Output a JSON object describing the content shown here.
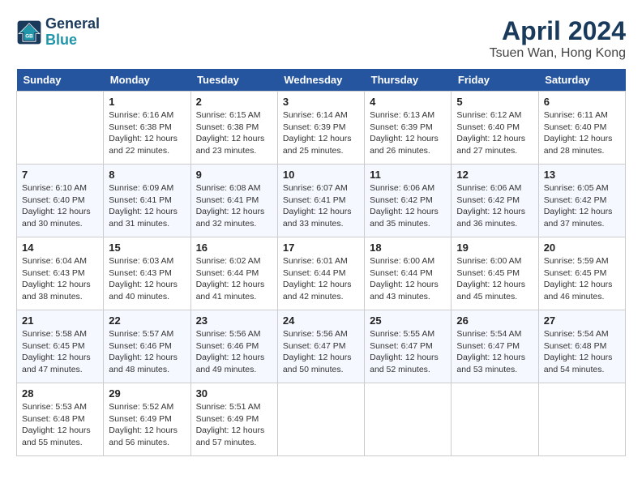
{
  "header": {
    "logo_line1": "General",
    "logo_line2": "Blue",
    "month": "April 2024",
    "location": "Tsuen Wan, Hong Kong"
  },
  "days_of_week": [
    "Sunday",
    "Monday",
    "Tuesday",
    "Wednesday",
    "Thursday",
    "Friday",
    "Saturday"
  ],
  "weeks": [
    [
      {
        "day": "",
        "info": ""
      },
      {
        "day": "1",
        "info": "Sunrise: 6:16 AM\nSunset: 6:38 PM\nDaylight: 12 hours\nand 22 minutes."
      },
      {
        "day": "2",
        "info": "Sunrise: 6:15 AM\nSunset: 6:38 PM\nDaylight: 12 hours\nand 23 minutes."
      },
      {
        "day": "3",
        "info": "Sunrise: 6:14 AM\nSunset: 6:39 PM\nDaylight: 12 hours\nand 25 minutes."
      },
      {
        "day": "4",
        "info": "Sunrise: 6:13 AM\nSunset: 6:39 PM\nDaylight: 12 hours\nand 26 minutes."
      },
      {
        "day": "5",
        "info": "Sunrise: 6:12 AM\nSunset: 6:40 PM\nDaylight: 12 hours\nand 27 minutes."
      },
      {
        "day": "6",
        "info": "Sunrise: 6:11 AM\nSunset: 6:40 PM\nDaylight: 12 hours\nand 28 minutes."
      }
    ],
    [
      {
        "day": "7",
        "info": "Sunrise: 6:10 AM\nSunset: 6:40 PM\nDaylight: 12 hours\nand 30 minutes."
      },
      {
        "day": "8",
        "info": "Sunrise: 6:09 AM\nSunset: 6:41 PM\nDaylight: 12 hours\nand 31 minutes."
      },
      {
        "day": "9",
        "info": "Sunrise: 6:08 AM\nSunset: 6:41 PM\nDaylight: 12 hours\nand 32 minutes."
      },
      {
        "day": "10",
        "info": "Sunrise: 6:07 AM\nSunset: 6:41 PM\nDaylight: 12 hours\nand 33 minutes."
      },
      {
        "day": "11",
        "info": "Sunrise: 6:06 AM\nSunset: 6:42 PM\nDaylight: 12 hours\nand 35 minutes."
      },
      {
        "day": "12",
        "info": "Sunrise: 6:06 AM\nSunset: 6:42 PM\nDaylight: 12 hours\nand 36 minutes."
      },
      {
        "day": "13",
        "info": "Sunrise: 6:05 AM\nSunset: 6:42 PM\nDaylight: 12 hours\nand 37 minutes."
      }
    ],
    [
      {
        "day": "14",
        "info": "Sunrise: 6:04 AM\nSunset: 6:43 PM\nDaylight: 12 hours\nand 38 minutes."
      },
      {
        "day": "15",
        "info": "Sunrise: 6:03 AM\nSunset: 6:43 PM\nDaylight: 12 hours\nand 40 minutes."
      },
      {
        "day": "16",
        "info": "Sunrise: 6:02 AM\nSunset: 6:44 PM\nDaylight: 12 hours\nand 41 minutes."
      },
      {
        "day": "17",
        "info": "Sunrise: 6:01 AM\nSunset: 6:44 PM\nDaylight: 12 hours\nand 42 minutes."
      },
      {
        "day": "18",
        "info": "Sunrise: 6:00 AM\nSunset: 6:44 PM\nDaylight: 12 hours\nand 43 minutes."
      },
      {
        "day": "19",
        "info": "Sunrise: 6:00 AM\nSunset: 6:45 PM\nDaylight: 12 hours\nand 45 minutes."
      },
      {
        "day": "20",
        "info": "Sunrise: 5:59 AM\nSunset: 6:45 PM\nDaylight: 12 hours\nand 46 minutes."
      }
    ],
    [
      {
        "day": "21",
        "info": "Sunrise: 5:58 AM\nSunset: 6:45 PM\nDaylight: 12 hours\nand 47 minutes."
      },
      {
        "day": "22",
        "info": "Sunrise: 5:57 AM\nSunset: 6:46 PM\nDaylight: 12 hours\nand 48 minutes."
      },
      {
        "day": "23",
        "info": "Sunrise: 5:56 AM\nSunset: 6:46 PM\nDaylight: 12 hours\nand 49 minutes."
      },
      {
        "day": "24",
        "info": "Sunrise: 5:56 AM\nSunset: 6:47 PM\nDaylight: 12 hours\nand 50 minutes."
      },
      {
        "day": "25",
        "info": "Sunrise: 5:55 AM\nSunset: 6:47 PM\nDaylight: 12 hours\nand 52 minutes."
      },
      {
        "day": "26",
        "info": "Sunrise: 5:54 AM\nSunset: 6:47 PM\nDaylight: 12 hours\nand 53 minutes."
      },
      {
        "day": "27",
        "info": "Sunrise: 5:54 AM\nSunset: 6:48 PM\nDaylight: 12 hours\nand 54 minutes."
      }
    ],
    [
      {
        "day": "28",
        "info": "Sunrise: 5:53 AM\nSunset: 6:48 PM\nDaylight: 12 hours\nand 55 minutes."
      },
      {
        "day": "29",
        "info": "Sunrise: 5:52 AM\nSunset: 6:49 PM\nDaylight: 12 hours\nand 56 minutes."
      },
      {
        "day": "30",
        "info": "Sunrise: 5:51 AM\nSunset: 6:49 PM\nDaylight: 12 hours\nand 57 minutes."
      },
      {
        "day": "",
        "info": ""
      },
      {
        "day": "",
        "info": ""
      },
      {
        "day": "",
        "info": ""
      },
      {
        "day": "",
        "info": ""
      }
    ]
  ]
}
